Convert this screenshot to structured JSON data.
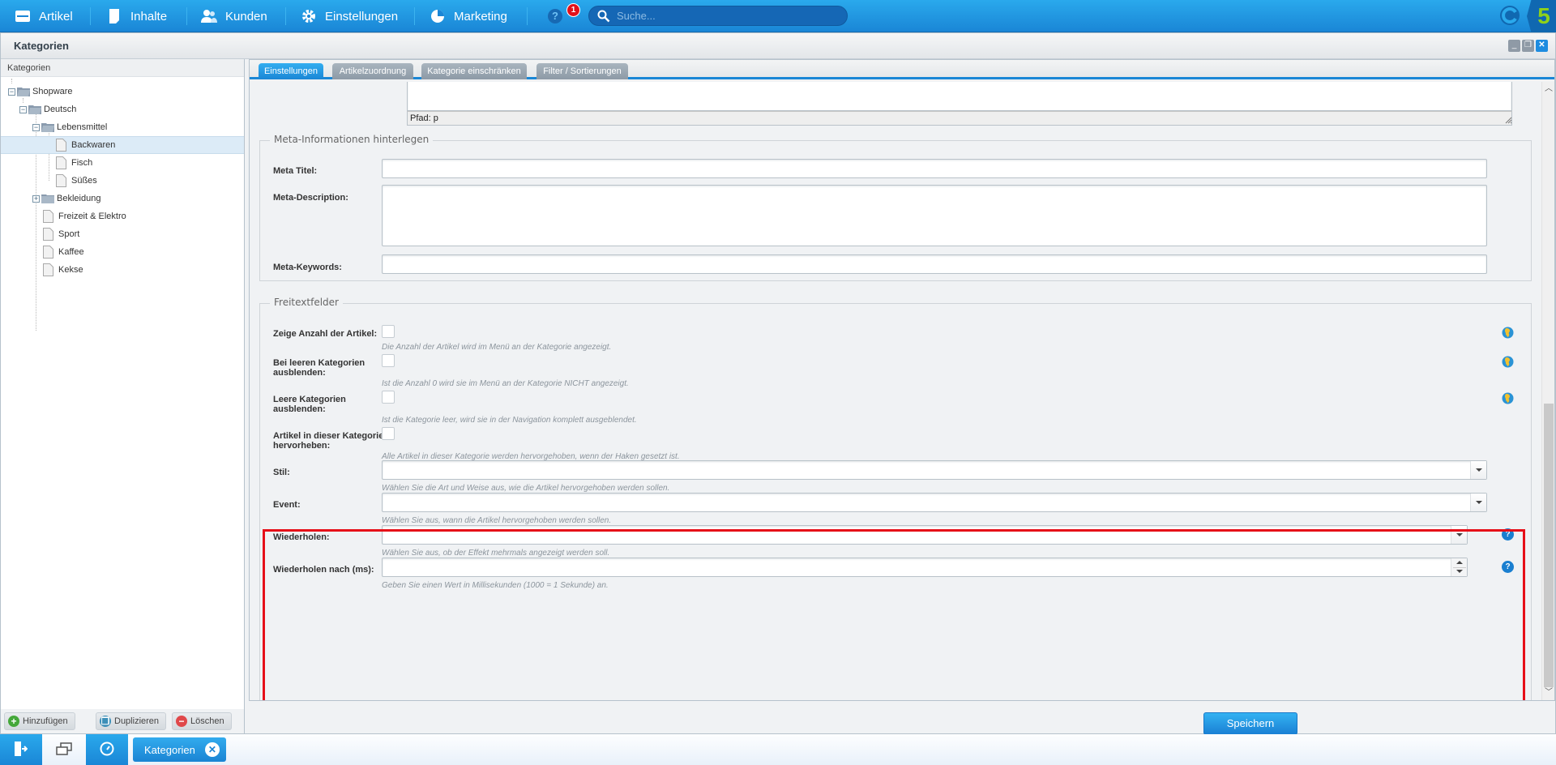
{
  "topbar": {
    "menu": [
      {
        "label": "Artikel",
        "icon": "inbox-icon"
      },
      {
        "label": "Inhalte",
        "icon": "document-icon"
      },
      {
        "label": "Kunden",
        "icon": "users-icon"
      },
      {
        "label": "Einstellungen",
        "icon": "gear-icon"
      },
      {
        "label": "Marketing",
        "icon": "pie-chart-icon"
      }
    ],
    "help_label": "?",
    "notification_count": "1",
    "search_placeholder": "Suche...",
    "logo_text": "5"
  },
  "window": {
    "title": "Kategorien",
    "controls": {
      "minimize": "_",
      "restore": "❐",
      "close": "✕"
    }
  },
  "tree": {
    "header": "Kategorien",
    "nodes": [
      {
        "label": "Shopware",
        "type": "folder",
        "expanded": true,
        "level": 0
      },
      {
        "label": "Deutsch",
        "type": "folder",
        "expanded": true,
        "level": 1
      },
      {
        "label": "Lebensmittel",
        "type": "folder",
        "expanded": true,
        "level": 2
      },
      {
        "label": "Backwaren",
        "type": "leaf",
        "level": 3,
        "selected": true
      },
      {
        "label": "Fisch",
        "type": "leaf",
        "level": 3
      },
      {
        "label": "Süßes",
        "type": "leaf",
        "level": 3
      },
      {
        "label": "Bekleidung",
        "type": "folder",
        "expanded": false,
        "level": 2
      },
      {
        "label": "Freizeit & Elektro",
        "type": "leaf",
        "level": 2
      },
      {
        "label": "Sport",
        "type": "leaf",
        "level": 2
      },
      {
        "label": "Kaffee",
        "type": "leaf",
        "level": 2
      },
      {
        "label": "Kekse",
        "type": "leaf",
        "level": 2
      }
    ],
    "buttons": {
      "add": "Hinzufügen",
      "duplicate": "Duplizieren",
      "delete": "Löschen"
    }
  },
  "tabs": [
    {
      "label": "Einstellungen",
      "active": true
    },
    {
      "label": "Artikelzuordnung",
      "active": false
    },
    {
      "label": "Kategorie einschränken",
      "active": false
    },
    {
      "label": "Filter / Sortierungen",
      "active": false
    }
  ],
  "editor": {
    "path_label": "Pfad: p"
  },
  "meta": {
    "legend": "Meta-Informationen hinterlegen",
    "title_label": "Meta Titel:",
    "title_value": "",
    "description_label": "Meta-Description:",
    "description_value": "",
    "keywords_label": "Meta-Keywords:",
    "keywords_value": ""
  },
  "freetext": {
    "legend": "Freitextfelder",
    "fields": [
      {
        "label": "Zeige Anzahl der Artikel:",
        "help": "Die Anzahl der Artikel wird im Menü an der Kategorie angezeigt.",
        "checked": false
      },
      {
        "label": "Bei leeren Kategorien ausblenden:",
        "help": "Ist die Anzahl 0 wird sie im Menü an der Kategorie NICHT angezeigt.",
        "checked": false
      },
      {
        "label": "Leere Kategorien ausblenden:",
        "help": "Ist die Kategorie leer, wird sie in der Navigation komplett ausgeblendet.",
        "checked": false
      },
      {
        "label": "Artikel in dieser Kategorie hervorheben:",
        "help": "Alle Artikel in dieser Kategorie werden hervorgehoben, wenn der Haken gesetzt ist.",
        "checked": false
      },
      {
        "label": "Stil:",
        "help": "Wählen Sie die Art und Weise aus, wie die Artikel hervorgehoben werden sollen.",
        "value": ""
      },
      {
        "label": "Event:",
        "help": "Wählen Sie aus, wann die Artikel hervorgehoben werden sollen.",
        "value": ""
      },
      {
        "label": "Wiederholen:",
        "help": "Wählen Sie aus, ob der Effekt mehrmals angezeigt werden soll.",
        "value": ""
      },
      {
        "label": "Wiederholen nach (ms):",
        "help": "Geben Sie einen Wert in Millisekunden (1000 = 1 Sekunde) an.",
        "value": ""
      }
    ],
    "help_icon": "?"
  },
  "footer": {
    "save_label": "Speichern"
  },
  "taskbar": {
    "task_label": "Kategorien",
    "task_close": "✕"
  },
  "colors": {
    "accent": "#1a86d6",
    "highlight_border": "#e60f18",
    "topbar": "#2aa9ec"
  }
}
